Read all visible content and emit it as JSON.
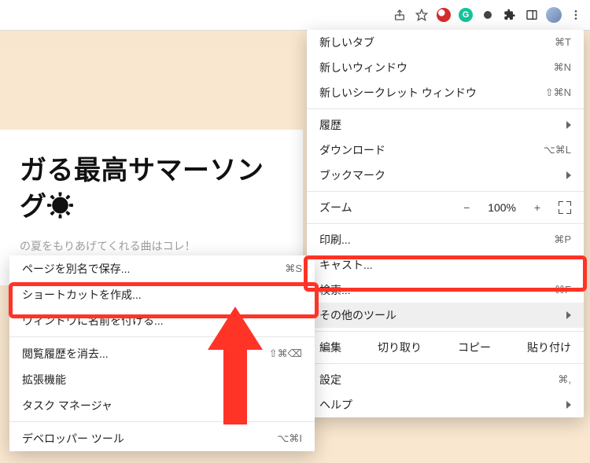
{
  "toolbar_icons": {
    "share": "share-icon",
    "star": "star-icon",
    "trend": "trend-micro-icon",
    "grammarly": "grammarly-icon",
    "more_ext": "extension-icon",
    "puzzle": "puzzle-icon",
    "panel": "side-panel-icon",
    "avatar": "profile-avatar",
    "kebab": "kebab-menu-icon"
  },
  "page": {
    "title_line": "ガる最高サマーソング☀",
    "subtitle": "の夏をもりあげてくれる曲はコレ！"
  },
  "main_menu": {
    "new_tab": {
      "label": "新しいタブ",
      "accel": "⌘T"
    },
    "new_window": {
      "label": "新しいウィンドウ",
      "accel": "⌘N"
    },
    "new_incognito": {
      "label": "新しいシークレット ウィンドウ",
      "accel": "⇧⌘N"
    },
    "history": {
      "label": "履歴"
    },
    "downloads": {
      "label": "ダウンロード",
      "accel": "⌥⌘L"
    },
    "bookmarks": {
      "label": "ブックマーク"
    },
    "zoom": {
      "label": "ズーム",
      "minus": "−",
      "pct": "100%",
      "plus": "+"
    },
    "print": {
      "label": "印刷...",
      "accel": "⌘P"
    },
    "cast": {
      "label": "キャスト..."
    },
    "find": {
      "label": "検索...",
      "accel": "⌘F"
    },
    "more_tools": {
      "label": "その他のツール"
    },
    "edit": {
      "label": "編集",
      "cut": "切り取り",
      "copy": "コピー",
      "paste": "貼り付け"
    },
    "settings": {
      "label": "設定",
      "accel": "⌘,"
    },
    "help": {
      "label": "ヘルプ"
    }
  },
  "sub_menu": {
    "save_as": {
      "label": "ページを別名で保存...",
      "accel": "⌘S"
    },
    "create_shortcut": {
      "label": "ショートカットを作成..."
    },
    "name_window": {
      "label": "ウィンドウに名前を付ける..."
    },
    "clear_history": {
      "label": "閲覧履歴を消去...",
      "accel": "⇧⌘⌫"
    },
    "extensions": {
      "label": "拡張機能"
    },
    "task_manager": {
      "label": "タスク マネージャ"
    },
    "dev_tools": {
      "label": "デベロッパー ツール",
      "accel": "⌥⌘I"
    }
  }
}
